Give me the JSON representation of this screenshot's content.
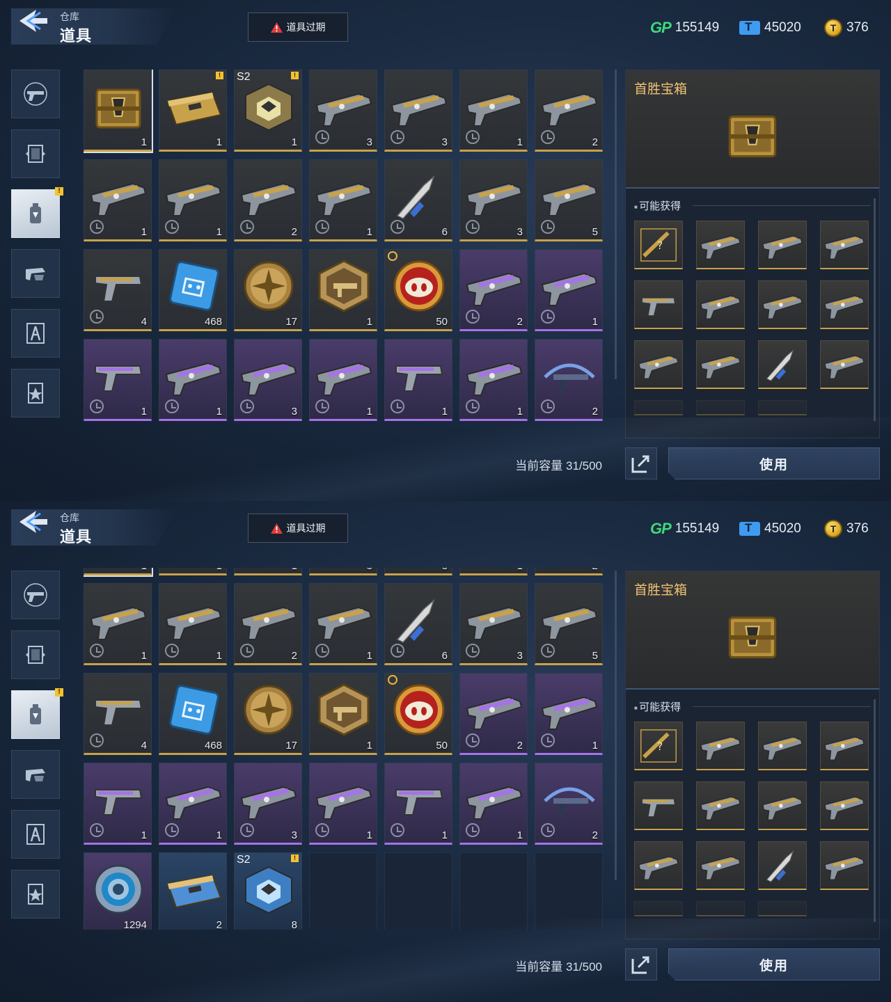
{
  "header": {
    "breadcrumb_parent": "仓库",
    "title": "道具"
  },
  "expired_button": {
    "label": "道具过期"
  },
  "currencies": {
    "gp_label": "GP",
    "gp": "155149",
    "tickets": "45020",
    "coins": "376"
  },
  "capacity_text": "当前容量 31/500",
  "detail": {
    "item_name": "首胜宝箱",
    "may_get_label": "可能获得",
    "use_label": "使用"
  },
  "colors": {
    "gold": "#c8a24a",
    "purple": "#a672e8",
    "blue": "#4f8fd6",
    "name": "#efc274"
  },
  "categories": [
    "pistol-icon",
    "frame-icon",
    "spray-can-icon",
    "gun-parts-icon",
    "character-icon",
    "star-badge-icon"
  ],
  "items": [
    {
      "icon": "crate-icon",
      "qty": "1",
      "rarity": "gold",
      "selected": true
    },
    {
      "icon": "case-icon",
      "qty": "1",
      "rarity": "gold",
      "badge": true
    },
    {
      "icon": "s2-cube-icon",
      "qty": "1",
      "rarity": "gold",
      "badge": true,
      "s2": "S2"
    },
    {
      "icon": "rifle-icon",
      "qty": "3",
      "rarity": "gold",
      "clock": true
    },
    {
      "icon": "rifle-icon",
      "qty": "3",
      "rarity": "gold",
      "clock": true
    },
    {
      "icon": "rifle-icon",
      "qty": "1",
      "rarity": "gold",
      "clock": true
    },
    {
      "icon": "rifle-icon",
      "qty": "2",
      "rarity": "gold",
      "clock": true
    },
    {
      "icon": "rifle-icon",
      "qty": "1",
      "rarity": "gold",
      "clock": true
    },
    {
      "icon": "rifle-icon",
      "qty": "1",
      "rarity": "gold",
      "clock": true
    },
    {
      "icon": "rifle-icon",
      "qty": "2",
      "rarity": "gold",
      "clock": true
    },
    {
      "icon": "rifle-icon",
      "qty": "1",
      "rarity": "gold",
      "clock": true
    },
    {
      "icon": "knife-icon",
      "qty": "6",
      "rarity": "gold",
      "clock": true
    },
    {
      "icon": "rifle-icon",
      "qty": "3",
      "rarity": "gold",
      "clock": true
    },
    {
      "icon": "rifle-icon",
      "qty": "5",
      "rarity": "gold",
      "clock": true
    },
    {
      "icon": "pistol-icon",
      "qty": "4",
      "rarity": "gold",
      "clock": true
    },
    {
      "icon": "chip-icon",
      "qty": "468",
      "rarity": "gold"
    },
    {
      "icon": "cross-medal-icon",
      "qty": "17",
      "rarity": "gold"
    },
    {
      "icon": "hex-medal-icon",
      "qty": "1",
      "rarity": "gold"
    },
    {
      "icon": "pig-coin-icon",
      "qty": "50",
      "rarity": "gold",
      "timer": true
    },
    {
      "icon": "rifle-icon",
      "qty": "2",
      "rarity": "purple",
      "clock": true
    },
    {
      "icon": "rifle-icon",
      "qty": "1",
      "rarity": "purple",
      "clock": true
    },
    {
      "icon": "pistol-icon",
      "qty": "1",
      "rarity": "purple",
      "clock": true
    },
    {
      "icon": "rifle-icon",
      "qty": "1",
      "rarity": "purple",
      "clock": true
    },
    {
      "icon": "rifle-icon",
      "qty": "3",
      "rarity": "purple",
      "clock": true
    },
    {
      "icon": "rifle-icon",
      "qty": "1",
      "rarity": "purple",
      "clock": true
    },
    {
      "icon": "pistol-icon",
      "qty": "1",
      "rarity": "purple",
      "clock": true
    },
    {
      "icon": "rifle-icon",
      "qty": "1",
      "rarity": "purple",
      "clock": true
    },
    {
      "icon": "crossbow-icon",
      "qty": "2",
      "rarity": "purple",
      "clock": true
    },
    {
      "icon": "ring-token-icon",
      "qty": "1294",
      "rarity": "purple"
    },
    {
      "icon": "case-icon",
      "qty": "2",
      "rarity": "blue"
    },
    {
      "icon": "s2-cube-icon",
      "qty": "8",
      "rarity": "blue",
      "badge": true,
      "s2": "S2"
    }
  ],
  "rewards": [
    "mystery-weapon-icon",
    "rifle-icon",
    "rifle-icon",
    "rifle-icon",
    "pistol-icon",
    "rifle-icon",
    "rifle-icon",
    "rifle-icon",
    "rifle-icon",
    "rifle-icon",
    "knife-icon",
    "rifle-icon"
  ]
}
